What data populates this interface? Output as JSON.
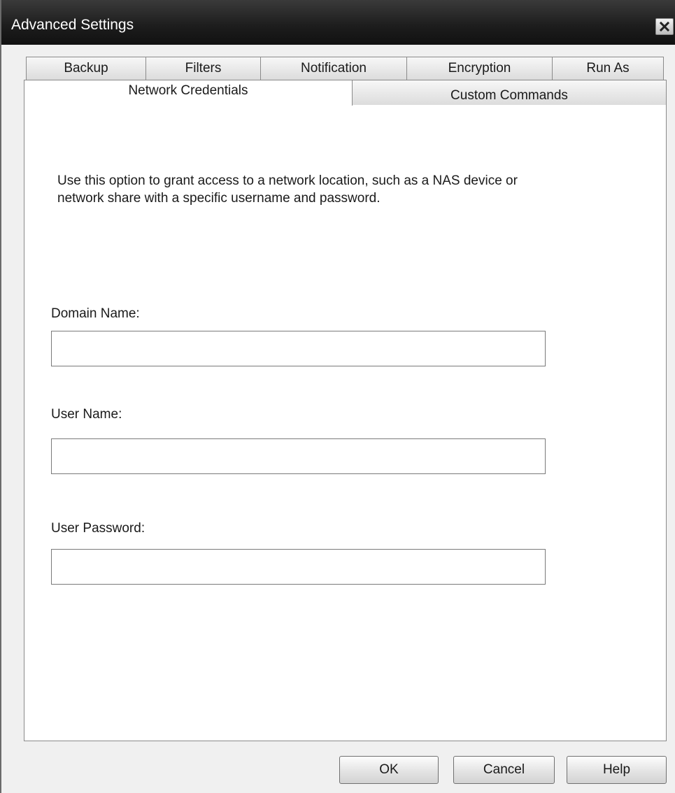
{
  "window": {
    "title": "Advanced Settings",
    "close_icon": "close-icon"
  },
  "tabs": {
    "row1": [
      {
        "label": "Backup"
      },
      {
        "label": "Filters"
      },
      {
        "label": "Notification"
      },
      {
        "label": "Encryption"
      },
      {
        "label": "Run As"
      }
    ],
    "row2": [
      {
        "label": "Network Credentials",
        "selected": true
      },
      {
        "label": "Custom Commands",
        "selected": false
      }
    ]
  },
  "panel": {
    "description": "Use this option to grant access to a network location, such as a NAS device or network share with a specific username and password.",
    "fields": [
      {
        "label": "Domain Name:",
        "value": "",
        "placeholder": ""
      },
      {
        "label": "User Name:",
        "value": "",
        "placeholder": ""
      },
      {
        "label": "User Password:",
        "value": "",
        "placeholder": ""
      }
    ]
  },
  "buttons": {
    "ok": "OK",
    "cancel": "Cancel",
    "help": "Help"
  }
}
